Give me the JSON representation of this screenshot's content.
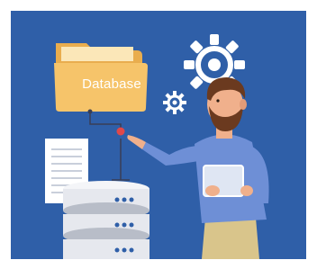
{
  "illustration": {
    "folder_label": "Database",
    "colors": {
      "background": "#2f5fa8",
      "folder": "#f6c46a",
      "folder_back": "#e9ad4e",
      "gear": "#ffffff",
      "shirt": "#6e8fd6",
      "skin": "#f0b08c",
      "hair": "#6b3a1f",
      "server": "#e6e8ee",
      "server_dark": "#b8bdc8",
      "tablet": "#dfe6f3",
      "pants": "#d9c58b"
    },
    "icons": [
      "folder-icon",
      "document-icon",
      "server-stack-icon",
      "gear-icon",
      "small-gear-icon",
      "tablet-icon",
      "person-figure"
    ]
  }
}
